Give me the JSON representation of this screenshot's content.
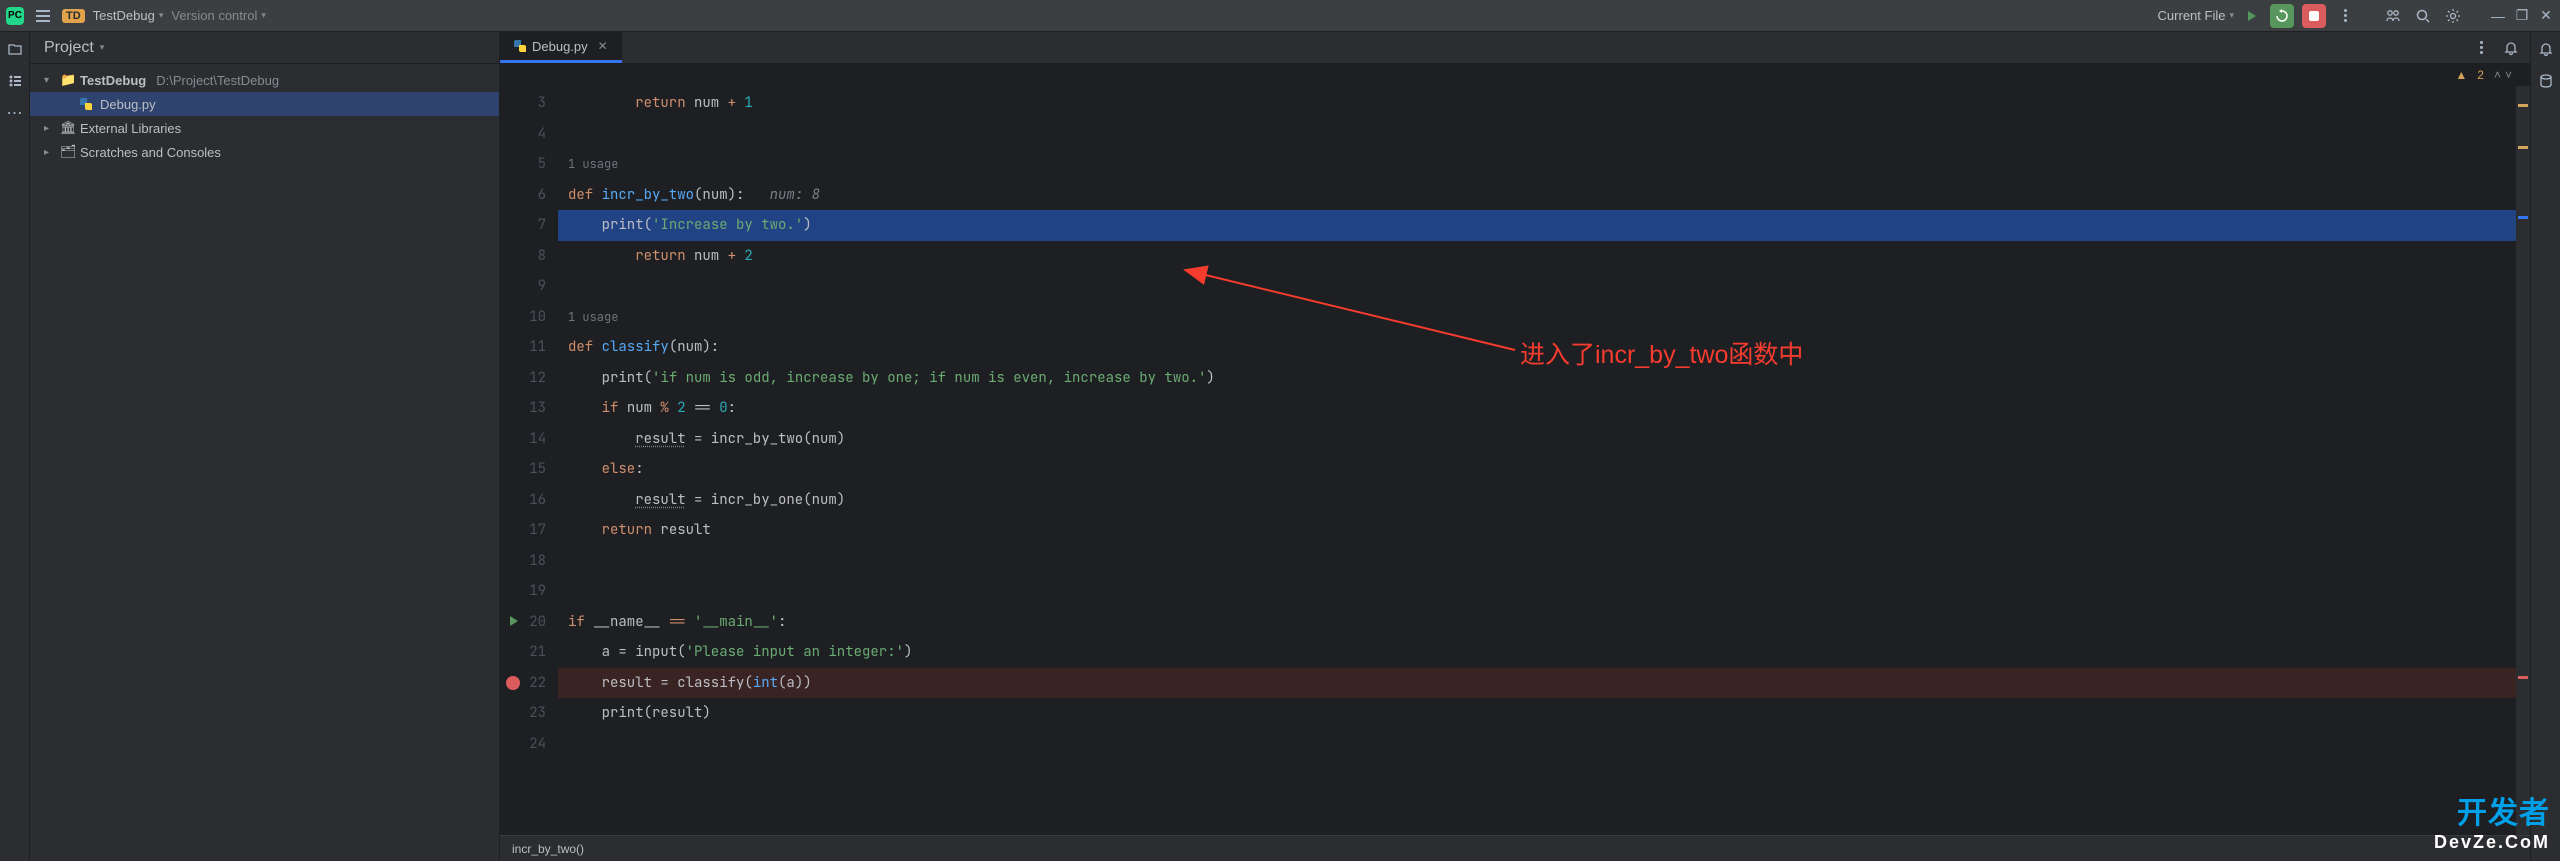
{
  "toolbar": {
    "project_badge": "TD",
    "project_name": "TestDebug",
    "version_control": "Version control",
    "current_file": "Current File"
  },
  "project_tree": {
    "header": "Project",
    "root": {
      "name": "TestDebug",
      "path": "D:\\Project\\TestDebug"
    },
    "file": "Debug.py",
    "external": "External Libraries",
    "scratches": "Scratches and Consoles"
  },
  "tab": {
    "name": "Debug.py"
  },
  "inspections": {
    "count": "2"
  },
  "gutter": {
    "lines": [
      "3",
      "4",
      "5",
      "6",
      "7",
      "8",
      "9",
      "10",
      "11",
      "12",
      "13",
      "14",
      "15",
      "16",
      "17",
      "18",
      "19",
      "20",
      "21",
      "22",
      "23",
      "24"
    ]
  },
  "code": {
    "l3a": "        ",
    "l3b": "return",
    "l3c": " num ",
    "l3d": "+ ",
    "l3e": "1",
    "u1": "1 usage",
    "l6a": "def ",
    "l6b": "incr_by_two",
    "l6c": "(num):   ",
    "l6d": "num: 8",
    "l7a": "    ",
    "l7b": "print",
    "l7c": "(",
    "l7d": "'Increase by two.'",
    "l7e": ")",
    "l8a": "        ",
    "l8b": "return",
    "l8c": " num ",
    "l8d": "+ ",
    "l8e": "2",
    "u2": "1 usage",
    "l11a": "def ",
    "l11b": "classify",
    "l11c": "(num):",
    "l12a": "    ",
    "l12b": "print",
    "l12c": "(",
    "l12d": "'if num is odd, increase by one; if num is even, increase by two.'",
    "l12e": ")",
    "l13a": "    ",
    "l13b": "if",
    "l13c": " num ",
    "l13d": "% ",
    "l13e": "2",
    "l13f": " == ",
    "l13g": "0",
    "l13h": ":",
    "l14a": "        ",
    "l14b": "result",
    "l14c": " = incr_by_two(num)",
    "l15a": "    ",
    "l15b": "else",
    "l15c": ":",
    "l16a": "        ",
    "l16b": "result",
    "l16c": " = incr_by_one(num)",
    "l17a": "    ",
    "l17b": "return",
    "l17c": " result",
    "l20a": "if",
    "l20b": " __name__ ",
    "l20c": "== ",
    "l20d": "'__main__'",
    "l20e": ":",
    "l21a": "    a = ",
    "l21b": "input",
    "l21c": "(",
    "l21d": "'Please input an integer:'",
    "l21e": ")",
    "l22a": "    result = classify(",
    "l22b": "int",
    "l22c": "(a))",
    "l23a": "    ",
    "l23b": "print",
    "l23c": "(result)"
  },
  "annotation": "进入了incr_by_two函数中",
  "breadcrumb": "incr_by_two()",
  "devze": {
    "l1": "开发者",
    "l2": "DevZe.CoM"
  }
}
